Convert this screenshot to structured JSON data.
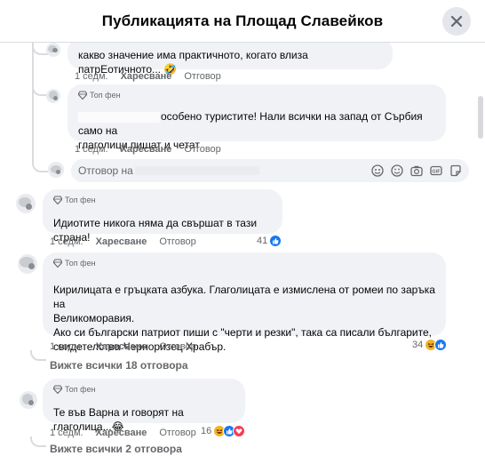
{
  "header": {
    "title": "Публикацията на Площад Славейков"
  },
  "comments": [
    {
      "text": "какво значение има практичното, когато влиза патрЕотичното... 🤣",
      "time": "1 седм.",
      "like": "Харесване",
      "reply": "Отговор"
    },
    {
      "badge": "Топ фен",
      "text1": "особено туристите! Нали всички на запад от Сърбия само на",
      "text2": "глаголици пишат и четат",
      "time": "1 седм.",
      "like": "Харесване",
      "reply": "Отговор"
    },
    {
      "badge": "Топ фен",
      "text": "Идиотите никога няма да свършат в тази страна!",
      "time": "1 седм.",
      "like": "Харесване",
      "reply": "Отговор",
      "reaction_count": "41"
    },
    {
      "badge": "Топ фен",
      "lines": [
        "Кирилицата е гръцката азбука. Глаголицата е измислена от ромеи по заръка на",
        "Великоморавия.",
        "Ако си български патриот пиши с \"черти и резки\", така са писали българите,",
        "свидетелства Черноризец Храбър."
      ],
      "time": "1 седм.",
      "like": "Харесване",
      "reply": "Отговор",
      "reaction_count": "34",
      "see_all": "Вижте всички 18 отговора"
    },
    {
      "badge": "Топ фен",
      "text": "Те във Варна и говорят на глаголица...😂",
      "time": "1 седм.",
      "like": "Харесване",
      "reply": "Отговор",
      "reaction_count": "16",
      "see_all": "Вижте всички 2 отговора"
    }
  ],
  "reply_input": {
    "placeholder_start": "Отговор на"
  },
  "icons": [
    "close-icon",
    "diamond-icon",
    "avatar-icon",
    "gif-icon",
    "emoji-icon",
    "camera-icon",
    "sticker-icon",
    "like-icon",
    "haha-icon",
    "love-icon"
  ],
  "colors": {
    "bubble": "#f0f2f5",
    "secondary_text": "#65676b",
    "like": "#1877f2",
    "haha": "#f7b125",
    "love": "#f33e58"
  }
}
